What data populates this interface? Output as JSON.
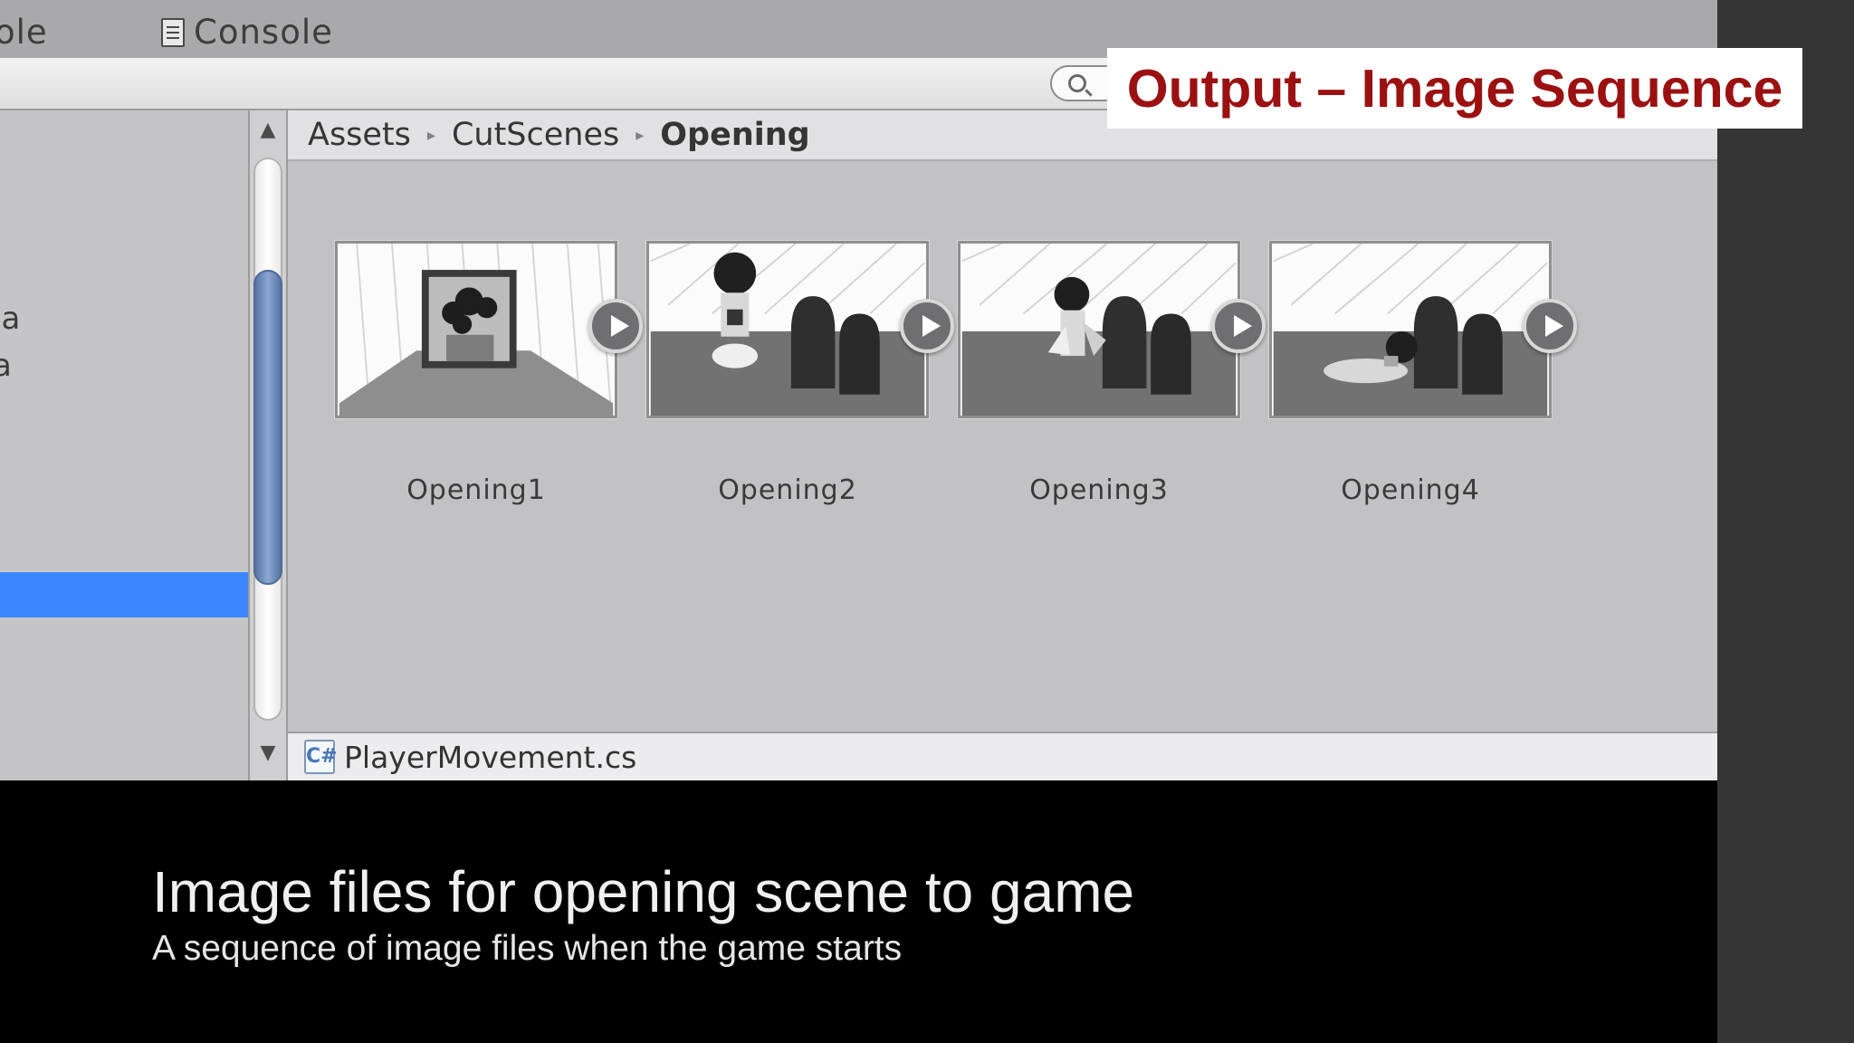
{
  "tabs": {
    "partial_tab": "ole",
    "console_label": "Console"
  },
  "left_panel": {
    "text_1": "ıa",
    "text_2": "a"
  },
  "breadcrumb": {
    "items": [
      "Assets",
      "CutScenes",
      "Opening"
    ],
    "separator": "▸"
  },
  "assets": [
    {
      "label": "Opening1"
    },
    {
      "label": "Opening2"
    },
    {
      "label": "Opening3"
    },
    {
      "label": "Opening4"
    }
  ],
  "status_bar": {
    "file_name": "PlayerMovement.cs",
    "icon_glyph": "C#"
  },
  "overlay": {
    "title": "Output – Image Sequence"
  },
  "caption": {
    "main": "Image files for opening scene to game",
    "sub": "A sequence of image files when the game starts"
  },
  "colors": {
    "title_red": "#9b1111",
    "selection_blue": "#3a86ff",
    "scroll_thumb": "#6f8bbd"
  }
}
